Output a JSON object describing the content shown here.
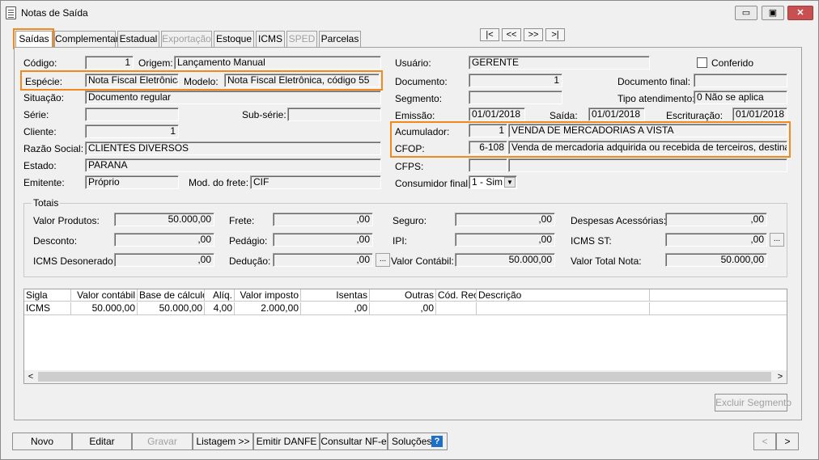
{
  "window": {
    "title": "Notas de Saída",
    "minimize": "▭",
    "maximize": "▣",
    "close": "✕"
  },
  "tabs": [
    {
      "label": "Saídas"
    },
    {
      "label": "Complementar"
    },
    {
      "label": "Estadual"
    },
    {
      "label": "Exportação"
    },
    {
      "label": "Estoque"
    },
    {
      "label": "ICMS"
    },
    {
      "label": "SPED"
    },
    {
      "label": "Parcelas"
    }
  ],
  "nav": {
    "first": "|<",
    "prev": "<<",
    "next": ">>",
    "last": ">|"
  },
  "form": {
    "codigo_label": "Código:",
    "codigo": "1",
    "origem_label": "Origem:",
    "origem": "Lançamento Manual",
    "especie_label": "Espécie:",
    "especie": "Nota Fiscal Eletrônica",
    "modelo_label": "Modelo:",
    "modelo": "Nota Fiscal Eletrônica, código 55",
    "situacao_label": "Situação:",
    "situacao": "Documento regular",
    "serie_label": "Série:",
    "serie": "",
    "subserie_label": "Sub-série:",
    "subserie": "",
    "cliente_label": "Cliente:",
    "cliente": "1",
    "razao_label": "Razão Social:",
    "razao": "CLIENTES DIVERSOS",
    "estado_label": "Estado:",
    "estado": "PARANA",
    "emitente_label": "Emitente:",
    "emitente": "Próprio",
    "frete_label": "Mod. do frete:",
    "frete": "CIF",
    "usuario_label": "Usuário:",
    "usuario": "GERENTE",
    "conferido_label": "Conferido",
    "documento_label": "Documento:",
    "documento": "1",
    "docfinal_label": "Documento final:",
    "docfinal": "",
    "segmento_label": "Segmento:",
    "segmento": "",
    "tipoatend_label": "Tipo atendimento:",
    "tipoatend": "0 Não se aplica",
    "emissao_label": "Emissão:",
    "emissao": "01/01/2018",
    "saida_label": "Saída:",
    "saida": "01/01/2018",
    "escrit_label": "Escrituração:",
    "escrit": "01/01/2018",
    "acumulador_label": "Acumulador:",
    "acumulador": "1",
    "acumulador_desc": "VENDA DE MERCADORIAS A VISTA",
    "cfop_label": "CFOP:",
    "cfop": "6-108",
    "cfop_desc": "Venda de mercadoria adquirida ou recebida de terceiros, destinada a não",
    "cfps_label": "CFPS:",
    "cfps": "",
    "cfps_desc": "",
    "consumidor_label": "Consumidor final:",
    "consumidor": "1 - Sim"
  },
  "totais": {
    "title": "Totais",
    "valor_produtos_label": "Valor Produtos:",
    "valor_produtos": "50.000,00",
    "frete_label": "Frete:",
    "frete": ",00",
    "seguro_label": "Seguro:",
    "seguro": ",00",
    "despesas_label": "Despesas Acessórias:",
    "despesas": ",00",
    "desconto_label": "Desconto:",
    "desconto": ",00",
    "pedagio_label": "Pedágio:",
    "pedagio": ",00",
    "ipi_label": "IPI:",
    "ipi": ",00",
    "icmsst_label": "ICMS ST:",
    "icmsst": ",00",
    "icmsdes_label": "ICMS Desonerado:",
    "icmsdes": ",00",
    "deducao_label": "Dedução:",
    "deducao": ",00",
    "valor_contabil_label": "Valor Contábil:",
    "valor_contabil": "50.000,00",
    "valor_total_label": "Valor Total Nota:",
    "valor_total": "50.000,00",
    "dots": "..."
  },
  "grid": {
    "headers": [
      "Sigla",
      "Valor contábil",
      "Base de cálculo",
      "Alíq.",
      "Valor imposto",
      "Isentas",
      "Outras",
      "Cód. Rec.",
      "Descrição"
    ],
    "rows": [
      [
        "ICMS",
        "50.000,00",
        "50.000,00",
        "4,00",
        "2.000,00",
        ",00",
        ",00",
        "",
        ""
      ]
    ],
    "scroll_left": "<",
    "scroll_right": ">"
  },
  "excluir_segmento": "Excluir Segmento",
  "buttons": {
    "novo": "Novo",
    "editar": "Editar",
    "gravar": "Gravar",
    "listagem": "Listagem >>",
    "emitir": "Emitir DANFE",
    "consultar": "Consultar NF-e",
    "solucoes": "Soluções",
    "help": "?",
    "prev": "<",
    "next": ">"
  }
}
